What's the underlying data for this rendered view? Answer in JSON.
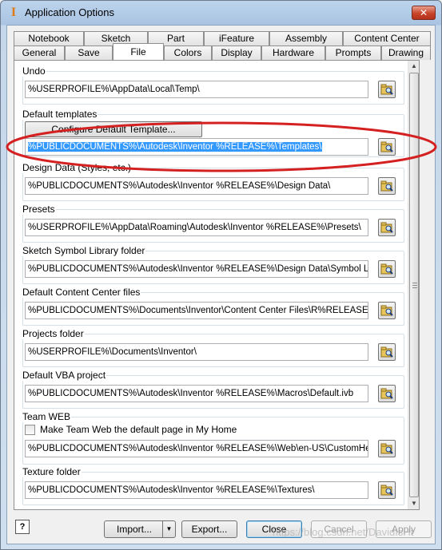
{
  "window": {
    "title": "Application Options",
    "app_icon": "I",
    "close_symbol": "✕"
  },
  "tabs": {
    "row1": [
      "Notebook",
      "Sketch",
      "Part",
      "iFeature",
      "Assembly",
      "Content Center"
    ],
    "row2": [
      "General",
      "Save",
      "File",
      "Colors",
      "Display",
      "Hardware",
      "Prompts",
      "Drawing"
    ],
    "active": "File"
  },
  "file_tab": {
    "undo": {
      "label": "Undo",
      "path": "%USERPROFILE%\\AppData\\Local\\Temp\\"
    },
    "default_templates": {
      "label": "Default templates",
      "configure_button": "Configure Default Template...",
      "path": "%PUBLICDOCUMENTS%\\Autodesk\\Inventor %RELEASE%\\Templates\\"
    },
    "design_data": {
      "label": "Design Data (Styles, etc.)",
      "path": "%PUBLICDOCUMENTS%\\Autodesk\\Inventor %RELEASE%\\Design Data\\"
    },
    "presets": {
      "label": "Presets",
      "path": "%USERPROFILE%\\AppData\\Roaming\\Autodesk\\Inventor %RELEASE%\\Presets\\"
    },
    "sketch_symbol_library": {
      "label": "Sketch Symbol Library folder",
      "path": "%PUBLICDOCUMENTS%\\Autodesk\\Inventor %RELEASE%\\Design Data\\Symbol Library\\"
    },
    "content_center_files": {
      "label": "Default Content Center files",
      "path": "%PUBLICDOCUMENTS%\\Documents\\Inventor\\Content Center Files\\R%RELEASE%\\"
    },
    "projects_folder": {
      "label": "Projects folder",
      "path": "%USERPROFILE%\\Documents\\Inventor\\"
    },
    "vba_project": {
      "label": "Default VBA project",
      "path": "%PUBLICDOCUMENTS%\\Autodesk\\Inventor %RELEASE%\\Macros\\Default.ivb"
    },
    "team_web": {
      "label": "Team WEB",
      "checkbox_label": "Make Team Web the default page in My Home",
      "checked": false,
      "path": "%PUBLICDOCUMENTS%\\Autodesk\\Inventor %RELEASE%\\Web\\en-US\\CustomHelpSamp"
    },
    "texture_folder": {
      "label": "Texture folder",
      "path": "%PUBLICDOCUMENTS%\\Autodesk\\Inventor %RELEASE%\\Textures\\"
    }
  },
  "footer": {
    "help": "?",
    "import": "Import...",
    "export": "Export...",
    "close": "Close",
    "cancel": "Cancel",
    "apply": "Apply"
  },
  "watermark": "https://blog.csdn.net/DavidIsHt",
  "colors": {
    "annotation": "#d42020",
    "selection": "#3399ff"
  },
  "icons": {
    "browse": "folder-browse-icon"
  }
}
